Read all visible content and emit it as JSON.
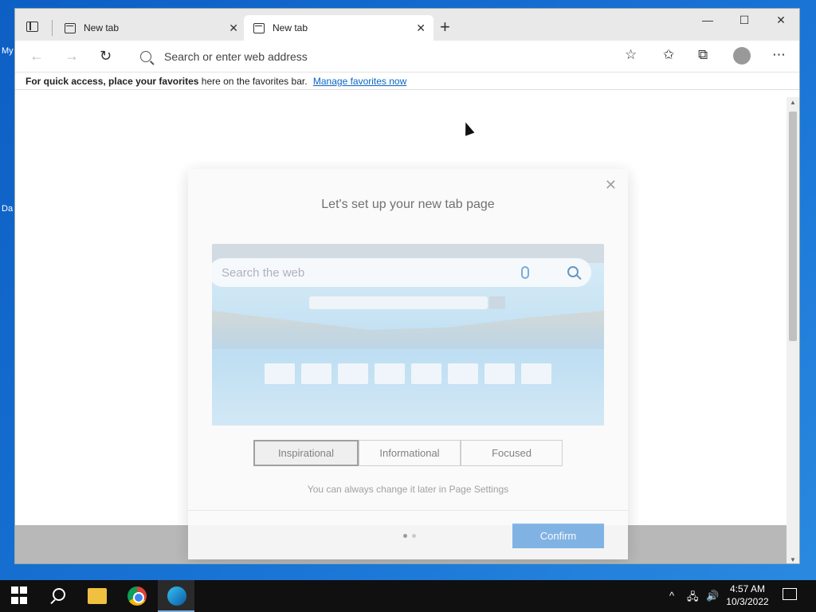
{
  "desktop": {
    "labels": [
      "My",
      "Da"
    ]
  },
  "browser": {
    "tabs": [
      {
        "label": "New tab",
        "active": false
      },
      {
        "label": "New tab",
        "active": true
      }
    ],
    "address_placeholder": "Search or enter web address",
    "favorites_bar": {
      "bold_text": "For quick access, place your favorites",
      "text": "here on the favorites bar.",
      "link": "Manage favorites now"
    }
  },
  "modal": {
    "title": "Let's set up your new tab page",
    "preview_search_placeholder": "Search the web",
    "options": [
      {
        "label": "Inspirational",
        "selected": true
      },
      {
        "label": "Informational",
        "selected": false
      },
      {
        "label": "Focused",
        "selected": false
      }
    ],
    "note": "You can always change it later in Page Settings",
    "confirm_label": "Confirm",
    "page_dots": {
      "total": 2,
      "current": 1
    }
  },
  "taskbar": {
    "time": "4:57 AM",
    "date": "10/3/2022"
  },
  "colors": {
    "accent": "#7cb3e8",
    "link": "#0a66c2",
    "taskbar": "#101010"
  }
}
